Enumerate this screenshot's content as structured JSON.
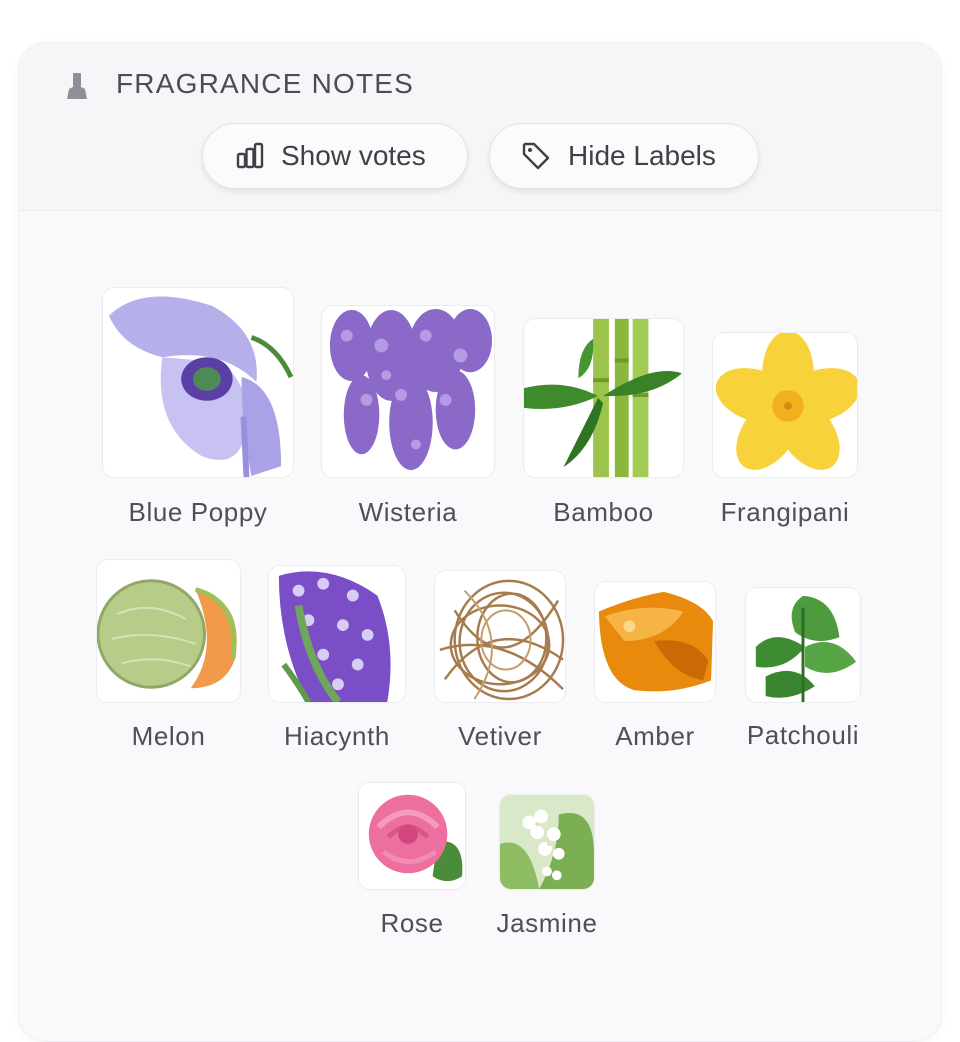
{
  "section": {
    "title": "FRAGRANCE NOTES",
    "icon": "perfume-bottle-icon"
  },
  "toolbar": {
    "show_votes_label": "Show votes",
    "show_votes_icon": "bar-chart-icon",
    "hide_labels_label": "Hide Labels",
    "hide_labels_icon": "tag-icon"
  },
  "notes": [
    {
      "name": "Blue Poppy"
    },
    {
      "name": "Wisteria"
    },
    {
      "name": "Bamboo"
    },
    {
      "name": "Frangipani"
    },
    {
      "name": "Melon"
    },
    {
      "name": "Hiacynth"
    },
    {
      "name": "Vetiver"
    },
    {
      "name": "Amber"
    },
    {
      "name": "Patchouli"
    },
    {
      "name": "Rose"
    },
    {
      "name": "Jasmine"
    }
  ]
}
